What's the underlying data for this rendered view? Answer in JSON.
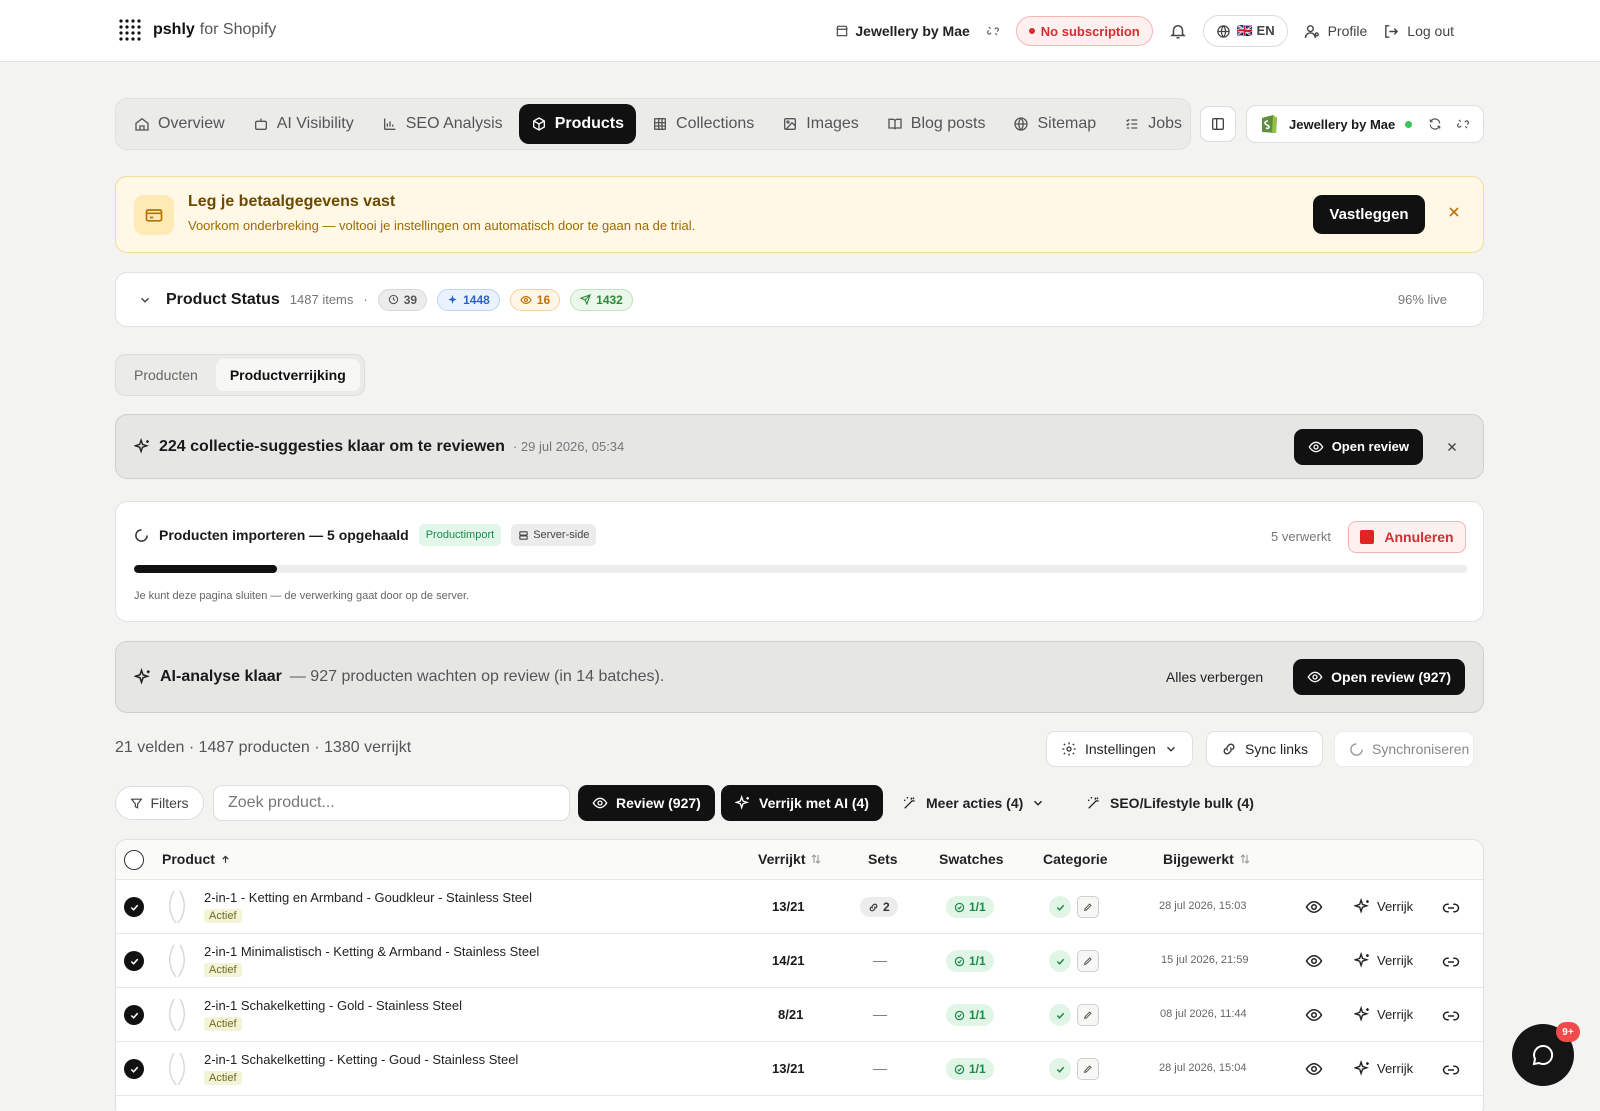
{
  "header": {
    "brand_name": "pshly",
    "brand_suffix": "for Shopify",
    "store_name": "Jewellery by Mae",
    "subscription_status": "No subscription",
    "language": "🇬🇧 EN",
    "profile_label": "Profile",
    "logout_label": "Log out"
  },
  "nav": {
    "tabs": [
      {
        "label": "Overview",
        "icon": "home-icon"
      },
      {
        "label": "AI Visibility",
        "icon": "robot-icon"
      },
      {
        "label": "SEO Analysis",
        "icon": "bar-chart-icon"
      },
      {
        "label": "Products",
        "icon": "box-icon",
        "active": true
      },
      {
        "label": "Collections",
        "icon": "grid-icon"
      },
      {
        "label": "Images",
        "icon": "image-icon"
      },
      {
        "label": "Blog posts",
        "icon": "book-icon"
      },
      {
        "label": "Sitemap",
        "icon": "globe-icon"
      },
      {
        "label": "Jobs",
        "icon": "list-icon"
      }
    ],
    "store_card_name": "Jewellery by Mae"
  },
  "billing_banner": {
    "title": "Leg je betaalgegevens vast",
    "description": "Voorkom onderbreking — voltooi je instellingen om automatisch door te gaan na de trial.",
    "button_label": "Vastleggen"
  },
  "product_status": {
    "title": "Product Status",
    "count": "1487 items",
    "separator": "·",
    "badges": {
      "pending": "39",
      "ai": "1448",
      "review": "16",
      "published": "1432"
    },
    "live": "96% live"
  },
  "segments": {
    "items": [
      "Producten",
      "Productverrijking"
    ],
    "active": "Productverrijking"
  },
  "suggestions": {
    "title": "224 collectie-suggesties klaar om te reviewen",
    "date": "· 29 jul 2026, 05:34",
    "button_label": "Open review"
  },
  "import": {
    "title": "Producten importeren — 5 opgehaald",
    "tag_import": "Productimport",
    "tag_server": "Server-side",
    "processed": "5 verwerkt",
    "cancel_label": "Annuleren",
    "progress": 0.107,
    "note": "Je kunt deze pagina sluiten — de verwerking gaat door op de server."
  },
  "ai_analysis": {
    "title": "AI-analyse klaar",
    "description": "— 927 producten wachten op review (in 14 batches).",
    "hide_label": "Alles verbergen",
    "button_label": "Open review (927)"
  },
  "summary": {
    "info": "21 velden · 1487 producten · 1380 verrijkt",
    "settings_label": "Instellingen",
    "sync_links_label": "Sync links",
    "sync_label": "Synchroniseren"
  },
  "toolbar": {
    "filters_label": "Filters",
    "search_placeholder": "Zoek product...",
    "review_label": "Review (927)",
    "enrich_label": "Verrijk met AI (4)",
    "more_label": "Meer acties (4)",
    "seo_bulk_label": "SEO/Lifestyle bulk (4)"
  },
  "table": {
    "columns": {
      "product": "Product",
      "enriched": "Verrijkt",
      "sets": "Sets",
      "swatches": "Swatches",
      "category": "Categorie",
      "updated": "Bijgewerkt"
    },
    "rows": [
      {
        "name": "2-in-1 - Ketting en Armband - Goudkleur - Stainless Steel",
        "status": "Actief",
        "enriched": "13/21",
        "sets": "2",
        "swatches": "1/1",
        "updated": "28 jul 2026, 15:03",
        "action": "Verrijk"
      },
      {
        "name": "2-in-1 Minimalistisch - Ketting & Armband - Stainless Steel",
        "status": "Actief",
        "enriched": "14/21",
        "sets": "—",
        "swatches": "1/1",
        "updated": "15 jul 2026, 21:59",
        "action": "Verrijk"
      },
      {
        "name": "2-in-1 Schakelketting - Gold - Stainless Steel",
        "status": "Actief",
        "enriched": "8/21",
        "sets": "—",
        "swatches": "1/1",
        "updated": "08 jul 2026, 11:44",
        "action": "Verrijk"
      },
      {
        "name": "2-in-1 Schakelketting - Ketting - Goud - Stainless Steel",
        "status": "Actief",
        "enriched": "13/21",
        "sets": "—",
        "swatches": "1/1",
        "updated": "28 jul 2026, 15:04",
        "action": "Verrijk"
      }
    ]
  },
  "chat": {
    "badge": "9+"
  },
  "colors": {
    "accent": "#111111",
    "danger": "#d0302f",
    "success": "#1e8a4c",
    "warning_bg": "#fff8e6"
  }
}
